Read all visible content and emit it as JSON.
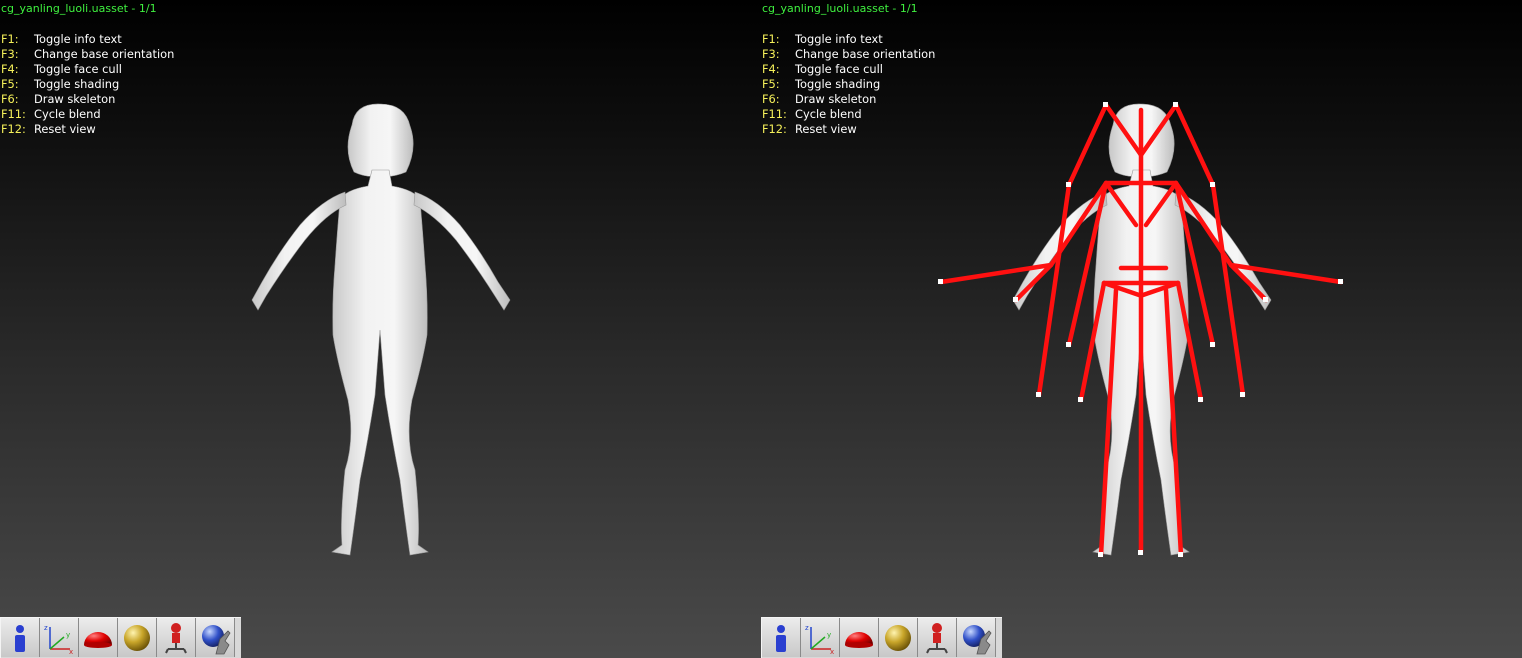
{
  "viewports": [
    {
      "title": "cg_yanling_luoli.uasset - 1/1",
      "shortcuts": [
        {
          "key": "F1:",
          "desc": "Toggle info text"
        },
        {
          "key": "F3:",
          "desc": "Change base orientation"
        },
        {
          "key": "F4:",
          "desc": "Toggle face cull"
        },
        {
          "key": "F5:",
          "desc": "Toggle shading"
        },
        {
          "key": "F6:",
          "desc": "Draw skeleton"
        },
        {
          "key": "F11:",
          "desc": "Cycle blend"
        },
        {
          "key": "F12:",
          "desc": "Reset view"
        }
      ],
      "skeleton_visible": false
    },
    {
      "title": "cg_yanling_luoli.uasset - 1/1",
      "shortcuts": [
        {
          "key": "F1:",
          "desc": "Toggle info text"
        },
        {
          "key": "F3:",
          "desc": "Change base orientation"
        },
        {
          "key": "F4:",
          "desc": "Toggle face cull"
        },
        {
          "key": "F5:",
          "desc": "Toggle shading"
        },
        {
          "key": "F6:",
          "desc": "Draw skeleton"
        },
        {
          "key": "F11:",
          "desc": "Cycle blend"
        },
        {
          "key": "F12:",
          "desc": "Reset view"
        }
      ],
      "skeleton_visible": true
    }
  ],
  "toolbar": [
    {
      "name": "info-icon",
      "glyph": "i"
    },
    {
      "name": "axes-icon",
      "glyph": "xyz"
    },
    {
      "name": "red-dome-icon",
      "glyph": ""
    },
    {
      "name": "gold-sphere-icon",
      "glyph": ""
    },
    {
      "name": "red-robot-icon",
      "glyph": ""
    },
    {
      "name": "globe-hand-icon",
      "glyph": ""
    }
  ],
  "colors": {
    "title": "#3ff03f",
    "key": "#f5f05a",
    "text": "#ffffff",
    "skeleton": "#ff1010",
    "model": "#e8e8e8"
  }
}
